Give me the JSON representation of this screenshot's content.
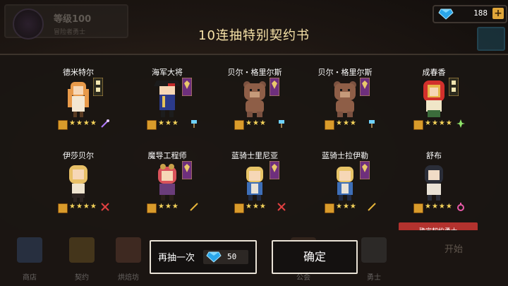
{
  "player": {
    "level_label": "等级100",
    "subtitle": "冒险者勇士"
  },
  "currency": {
    "gems": "188",
    "add_label": "+"
  },
  "modal": {
    "title": "10连抽特别契约书",
    "confirmed_label": "确定契约勇士",
    "again_label": "再抽一次",
    "again_cost": "50",
    "ok_label": "确定"
  },
  "heroes": [
    {
      "name": "德米特尔",
      "stars": "★★★★",
      "weapon_icon": "staff-icon",
      "banner_color": "#6e2f7d"
    },
    {
      "name": "海军大将",
      "stars": "★★★",
      "weapon_icon": "hammer-icon",
      "banner_color": "#6e2f7d"
    },
    {
      "name": "贝尔・格里尔斯",
      "stars": "★★★",
      "weapon_icon": "hammer-icon",
      "banner_color": "#6e2f7d"
    },
    {
      "name": "贝尔・格里尔斯",
      "stars": "★★★",
      "weapon_icon": "hammer-icon",
      "banner_color": "#6e2f7d"
    },
    {
      "name": "成春香",
      "stars": "★★★★",
      "weapon_icon": "shuriken-icon",
      "banner_color": "#6e2f7d"
    },
    {
      "name": "伊莎贝尔",
      "stars": "★★★★",
      "weapon_icon": "swords-icon",
      "banner_color": "#6e2f7d"
    },
    {
      "name": "魔导工程师",
      "stars": "★★★",
      "weapon_icon": "wand-icon",
      "banner_color": "#6e2f7d"
    },
    {
      "name": "蓝骑士里尼亚",
      "stars": "★★★",
      "weapon_icon": "swords-icon",
      "banner_color": "#6e2f7d"
    },
    {
      "name": "蓝骑士拉伊勒",
      "stars": "★★★",
      "weapon_icon": "wand-icon",
      "banner_color": "#6e2f7d"
    },
    {
      "name": "舒布",
      "stars": "★★★★",
      "weapon_icon": "ring-icon",
      "banner_color": "#6e2f7d"
    }
  ],
  "bottom_menu": [
    {
      "label": "商店",
      "color": "#3c5a8a"
    },
    {
      "label": "契约",
      "color": "#8a6a2a"
    },
    {
      "label": "烘焙坊",
      "color": "#7a4a3a"
    },
    {
      "label": "公会",
      "color": "#5a3d2d"
    },
    {
      "label": "勇士",
      "color": "#4a4a4a"
    }
  ],
  "start_label": "开始"
}
